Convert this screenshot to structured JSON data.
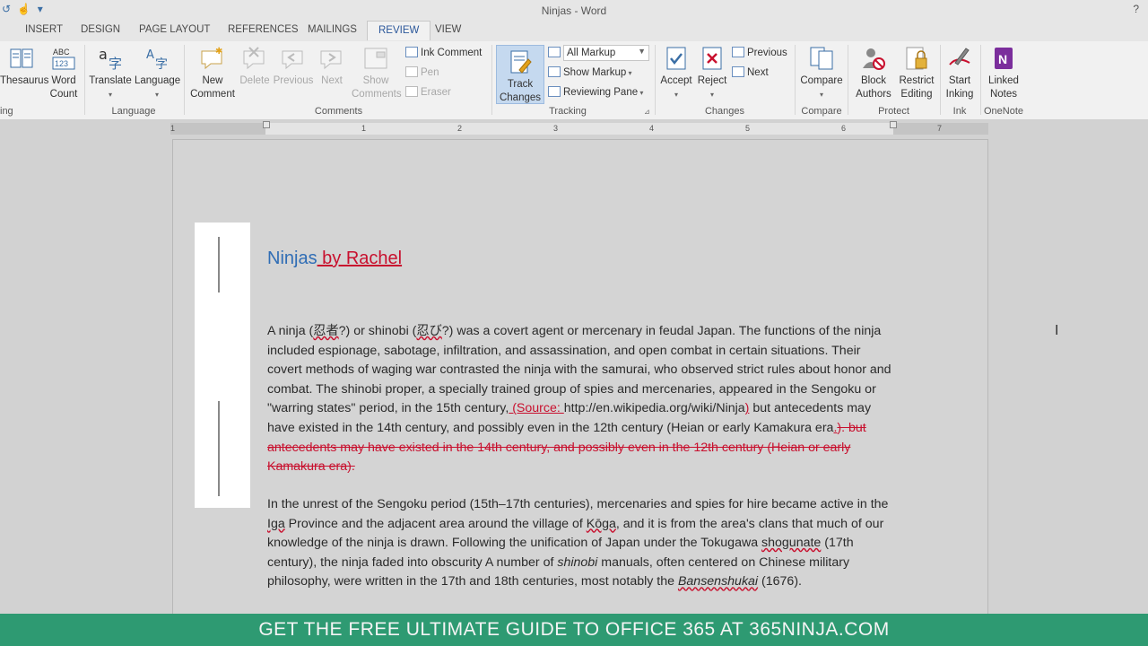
{
  "window": {
    "title": "Ninjas - Word",
    "help": "?"
  },
  "tabs": [
    {
      "label": "INSERT"
    },
    {
      "label": "DESIGN"
    },
    {
      "label": "PAGE LAYOUT"
    },
    {
      "label": "REFERENCES"
    },
    {
      "label": "MAILINGS"
    },
    {
      "label": "REVIEW"
    },
    {
      "label": "VIEW"
    }
  ],
  "ribbon": {
    "proofing": {
      "thesaurus": "Thesaurus",
      "word_count_1": "Word",
      "word_count_2": "Count",
      "group": "ing"
    },
    "language": {
      "translate": "Translate",
      "language": "Language",
      "group": "Language"
    },
    "comments": {
      "new_1": "New",
      "new_2": "Comment",
      "delete": "Delete",
      "previous": "Previous",
      "next": "Next",
      "show_1": "Show",
      "show_2": "Comments",
      "ink_comment": "Ink Comment",
      "pen": "Pen",
      "eraser": "Eraser",
      "group": "Comments"
    },
    "tracking": {
      "track_1": "Track",
      "track_2": "Changes",
      "markup_value": "All Markup",
      "show_markup": "Show Markup",
      "reviewing_pane": "Reviewing Pane",
      "group": "Tracking"
    },
    "changes": {
      "accept": "Accept",
      "reject": "Reject",
      "previous": "Previous",
      "next": "Next",
      "group": "Changes"
    },
    "compare": {
      "compare": "Compare",
      "group": "Compare"
    },
    "protect": {
      "block_1": "Block",
      "block_2": "Authors",
      "restrict_1": "Restrict",
      "restrict_2": "Editing",
      "group": "Protect"
    },
    "ink": {
      "start_1": "Start",
      "start_2": "Inking",
      "group": "Ink"
    },
    "onenote": {
      "linked_1": "Linked",
      "linked_2": "Notes",
      "group": "OneNote"
    }
  },
  "ruler": {
    "numbers": [
      "1",
      "1",
      "2",
      "3",
      "4",
      "5",
      "6",
      "7"
    ]
  },
  "document": {
    "title": "Ninjas",
    "title_insert": " by Rachel",
    "p1": {
      "a": "A ninja (",
      "kanji1": "忍者",
      "b": "?) or shinobi (",
      "kanji2": "忍び",
      "c": "?) was a covert agent or mercenary in feudal Japan. The functions of the ninja included espionage, sabotage, infiltration, and assassination, and open combat in certain situations. Their covert methods of waging war contrasted the ninja with the samurai, who observed strict rules about honor and combat. The shinobi proper, a specially trained group of spies and mercenaries, appeared in the Sengoku or \"warring states\" period, in the 15th century,",
      "ins1": " (Source: ",
      "url": "http://en.wikipedia.org/wiki/Ninja",
      "ins2": ")",
      "d": " but antecedents may have existed in the 14th century, and possibly even in the 12th century (Heian or early Kamakura era",
      "ins3": ".",
      "del1": "). but antecedents may have existed in the 14th century, and possibly even in the 12th century (Heian or early Kamakura era)."
    },
    "p2": {
      "a": "In the unrest of the Sengoku period (15th–17th centuries), mercenaries and spies for hire became active in the ",
      "iga": "Iga",
      "b": " Province and the adjacent area around the village of ",
      "koga": "Kōga",
      "c": ", and it is from the area's clans that much of our knowledge of the ninja is drawn. Following the unification of Japan under the Tokugawa ",
      "shogunate": "shogunate",
      "d": " (17th century), the ninja faded into obscurity A number of ",
      "shinobi": "shinobi",
      "e": " manuals, often centered on Chinese military philosophy, were written in the 17th and 18th centuries, most notably the ",
      "bansen": "Bansenshukai",
      "f": " (1676)."
    }
  },
  "banner": {
    "text": "GET THE FREE ULTIMATE GUIDE TO OFFICE 365 AT 365NINJA.COM"
  },
  "colors": {
    "accent": "#2b579a",
    "insert": "#c8102e",
    "banner": "#2e9a72"
  }
}
